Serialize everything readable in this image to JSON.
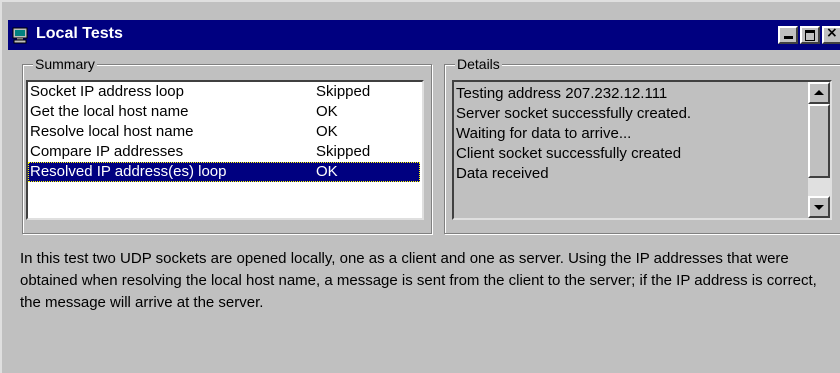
{
  "window": {
    "title": "Local Tests"
  },
  "summary": {
    "label": "Summary",
    "rows": [
      {
        "name": "Socket IP address loop",
        "status": "Skipped"
      },
      {
        "name": "Get the local host name",
        "status": "OK"
      },
      {
        "name": "Resolve local host name",
        "status": "OK"
      },
      {
        "name": "Compare IP addresses",
        "status": "Skipped"
      },
      {
        "name": "Resolved IP address(es) loop",
        "status": "OK"
      }
    ]
  },
  "details": {
    "label": "Details",
    "lines": [
      "Testing address 207.232.12.111",
      "Server socket successfully created.",
      "Waiting for data to arrive...",
      "Client socket successfully created",
      "Data received"
    ]
  },
  "description": "In this test two UDP sockets are opened locally, one as a client and one as server.  Using the IP addresses that were obtained when resolving the local host name, a message is sent from the client to the server; if the IP address is correct, the message will arrive at the server.",
  "colors": {
    "titlebar": "#000080",
    "selection": "#000080",
    "face": "#c0c0c0"
  }
}
